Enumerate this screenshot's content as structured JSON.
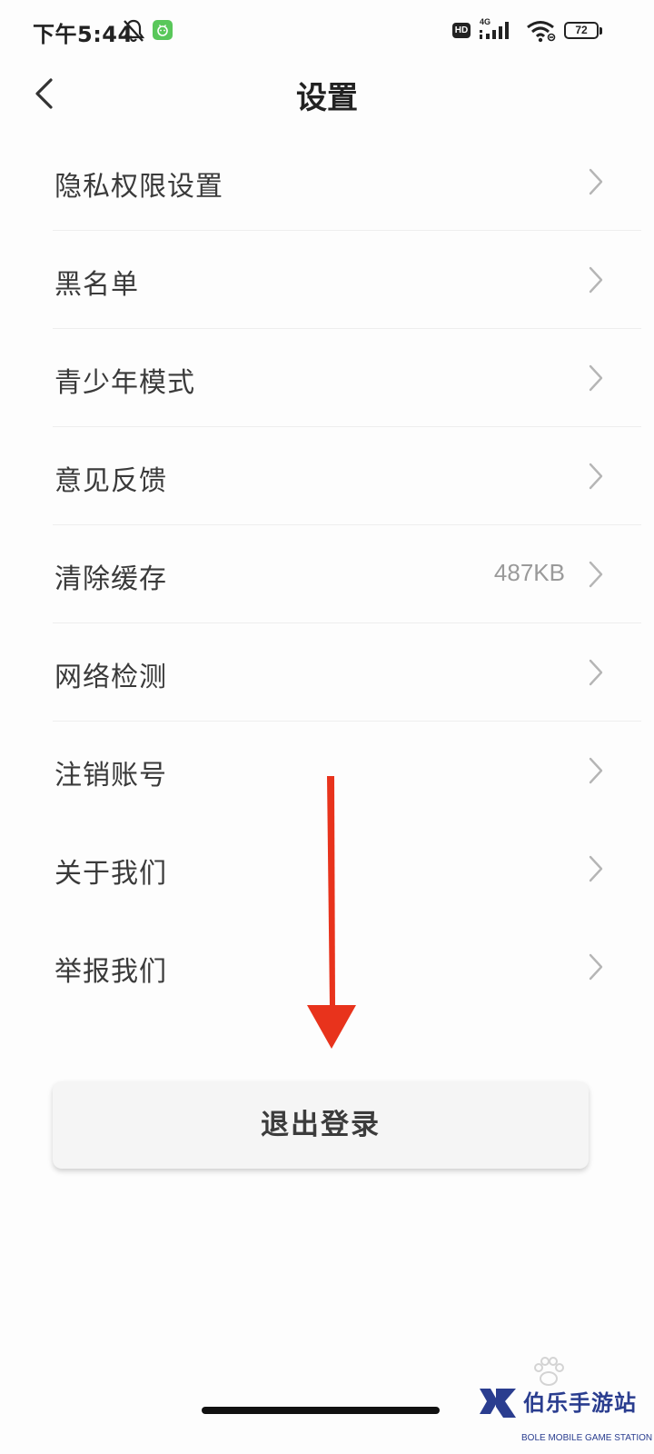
{
  "status_bar": {
    "time": "下午5:44",
    "hd_label": "HD",
    "network_type": "4G",
    "battery": "72",
    "icons": [
      "bell-off-icon",
      "app-notification-icon",
      "hd-icon",
      "signal-icon",
      "wifi-icon",
      "battery-icon"
    ]
  },
  "header": {
    "title": "设置",
    "back_icon": "chevron-left-icon"
  },
  "settings": {
    "items": [
      {
        "label": "隐私权限设置",
        "value": ""
      },
      {
        "label": "黑名单",
        "value": ""
      },
      {
        "label": "青少年模式",
        "value": ""
      },
      {
        "label": "意见反馈",
        "value": ""
      },
      {
        "label": "清除缓存",
        "value": "487KB"
      },
      {
        "label": "网络检测",
        "value": ""
      },
      {
        "label": "注销账号",
        "value": ""
      },
      {
        "label": "关于我们",
        "value": ""
      },
      {
        "label": "举报我们",
        "value": ""
      }
    ]
  },
  "logout": {
    "label": "退出登录"
  },
  "watermark": {
    "brand_name": "伯乐手游站",
    "brand_sub": "BOLE MOBILE GAME STATION"
  },
  "colors": {
    "annotation_arrow": "#e8331c",
    "brand": "#2a3d8f",
    "app_notification": "#59c75a"
  }
}
